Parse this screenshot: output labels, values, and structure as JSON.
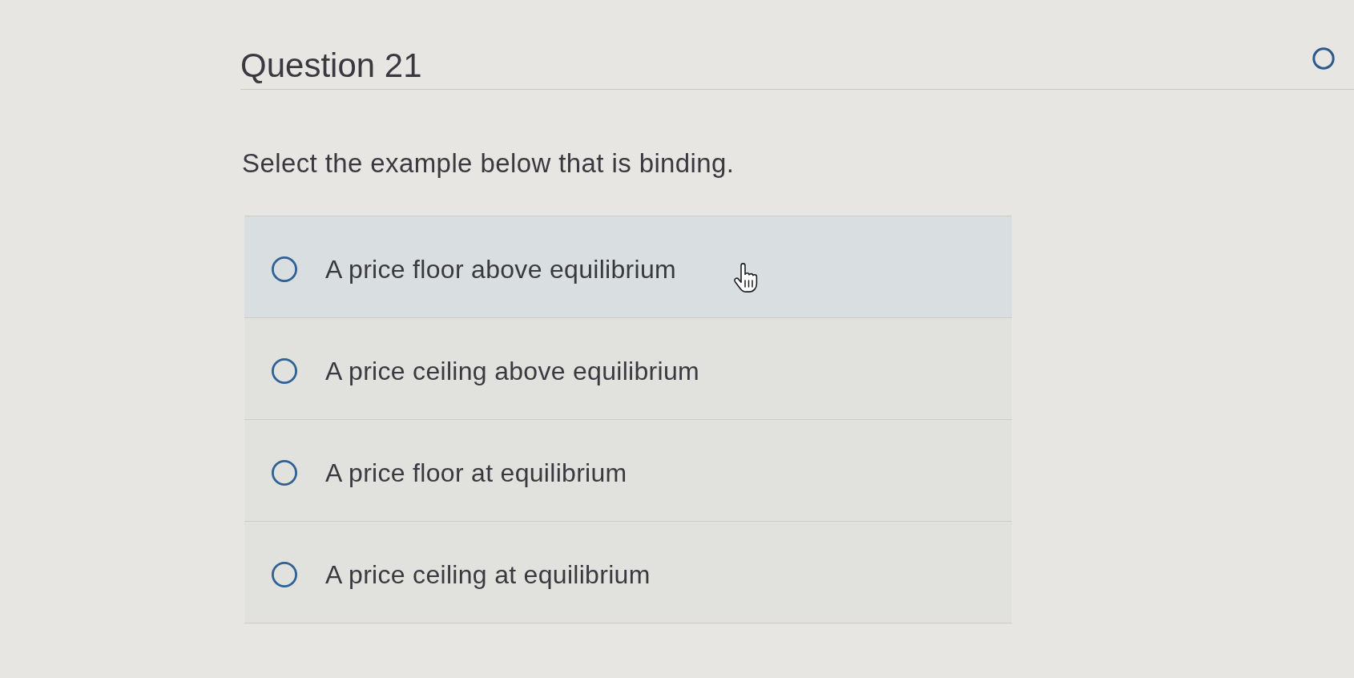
{
  "question": {
    "title": "Question 21",
    "prompt": "Select the example below that is binding."
  },
  "options": [
    {
      "label": "A price floor above equilibrium",
      "selected": false,
      "hovered": true
    },
    {
      "label": "A price ceiling above equilibrium",
      "selected": false,
      "hovered": false
    },
    {
      "label": "A price floor at equilibrium",
      "selected": false,
      "hovered": false
    },
    {
      "label": "A price ceiling at equilibrium",
      "selected": false,
      "hovered": false
    }
  ]
}
